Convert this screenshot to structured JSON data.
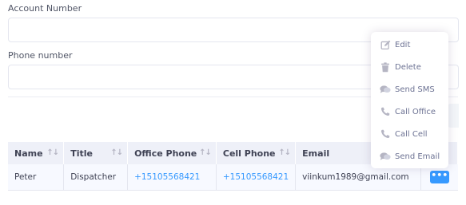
{
  "form": {
    "account_number_label": "Account Number",
    "account_number_value": "",
    "phone_number_label": "Phone number",
    "phone_number_value": ""
  },
  "table": {
    "headers": [
      "Name",
      "Title",
      "Office Phone",
      "Cell Phone",
      "Email"
    ],
    "rows": [
      {
        "name": "Peter",
        "title": "Dispatcher",
        "office_phone": "+15105568421",
        "cell_phone": "+15105568421",
        "email": "viinkum1989@gmail.com",
        "actions_label": "•••"
      }
    ]
  },
  "context_menu": {
    "items": [
      {
        "label": "Edit",
        "icon": "edit-icon"
      },
      {
        "label": "Delete",
        "icon": "trash-icon"
      },
      {
        "label": "Send SMS",
        "icon": "chat-icon"
      },
      {
        "label": "Call Office",
        "icon": "phone-icon"
      },
      {
        "label": "Call Cell",
        "icon": "phone-icon"
      },
      {
        "label": "Send Email",
        "icon": "chat-icon"
      }
    ]
  },
  "colors": {
    "accent": "#3699ff",
    "header_bg": "#eef0f8",
    "row_bg": "#f7f9ff",
    "menu_text": "#6c7293",
    "menu_icon": "#b5b5c3"
  }
}
